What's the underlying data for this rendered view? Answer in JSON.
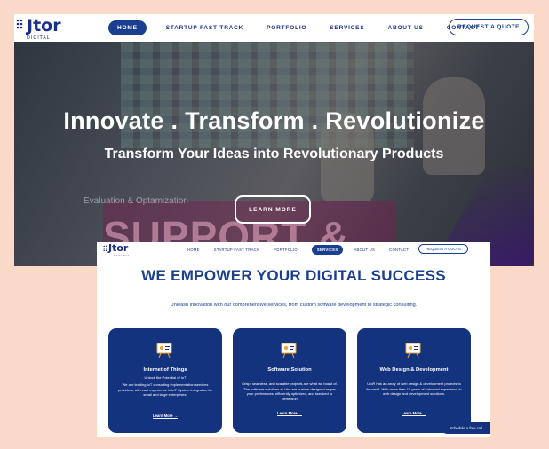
{
  "shot1": {
    "logo": {
      "mark": "Jtor",
      "sub": "DIGITAL"
    },
    "nav": [
      "HOME",
      "STARTUP FAST TRACK",
      "PORTFOLIO",
      "SERVICES",
      "ABOUT US",
      "CONTACT"
    ],
    "active_nav": "HOME",
    "request_button": "REQUEST A QUOTE",
    "hero": {
      "headline": "Innovate . Transform . Revolutionize",
      "subheadline": "Transform Your Ideas into Revolutionary Products",
      "button": "LEARN MORE",
      "bg_text_small": "Evaluation & Optamization",
      "bg_text_large": "SUPPORT &"
    }
  },
  "shot2": {
    "logo": {
      "mark": "Jtor",
      "sub": "DIGITAL"
    },
    "nav": [
      "HOME",
      "STARTUP FAST TRACK",
      "PORTFOLIO",
      "SERVICES",
      "ABOUT US",
      "CONTACT"
    ],
    "active_nav": "SERVICES",
    "request_button": "REQUEST A QUOTE",
    "title": "WE EMPOWER YOUR DIGITAL SUCCESS",
    "subtitle": "Unleash innovation with our comprehensive services, from custom software development to strategic consulting.",
    "cards": [
      {
        "title": "Internet of Things",
        "tag": "Unlock the Potential of IoT",
        "desc": "We are leading IoT consulting implementation services providers, with vast experience in IoT System Integration for small and large enterprises.",
        "more": "Learn More →"
      },
      {
        "title": "Software Solution",
        "tag": "",
        "desc": "Crisp, seamless, and scalable projects are what we boast of. The software solutions at Utor are custom designed as per your preferences, efficiently optimized, and tweaked to perfection",
        "more": "Learn More →"
      },
      {
        "title": "Web Design & Development",
        "tag": "",
        "desc": "UIoR has an array of web design & development projects to its credit. With more than 15 years of industrial experience in web design and development solutions.",
        "more": "Learn More →"
      }
    ],
    "chat_button": "Schedule a free call"
  },
  "colors": {
    "brand": "#1b3f90",
    "card": "#14337f",
    "page_bg": "#fbd9c9"
  }
}
